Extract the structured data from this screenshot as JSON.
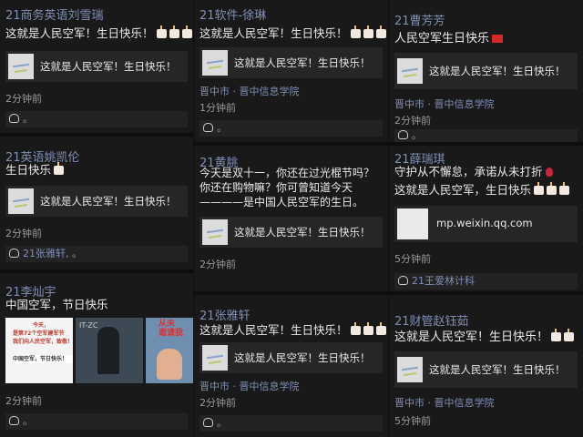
{
  "posts": {
    "p1": {
      "name": "21商务英语刘雪瑞",
      "text": "这就是人民空军！生日快乐！",
      "card": "这就是人民空军！生日快乐！",
      "time": "2分钟前",
      "likes": "。"
    },
    "p2": {
      "name": "21英语姚凯伦",
      "text": "生日快乐",
      "card": "这就是人民空军！生日快乐！",
      "time": "2分钟前",
      "likes": "21张雅轩, 。"
    },
    "p3": {
      "name": "21李灿宇",
      "text": "中国空军，节日快乐",
      "img1_lines": [
        "今天，",
        "是第72个空军建军节",
        "我们向人民空军，致敬！",
        "中国空军，节日快乐！"
      ],
      "img2_label": "IT-ZC",
      "img3_lines": [
        "从",
        "未",
        "邀",
        "请",
        "我"
      ],
      "time": "2分钟前",
      "likes": "。"
    },
    "p4": {
      "name": "21软件-徐琳",
      "text": "这就是人民空军！生日快乐！",
      "card": "这就是人民空军！生日快乐！",
      "loc": "晋中市 · 晋中信息学院",
      "time": "1分钟前",
      "likes": "。"
    },
    "p5": {
      "name": "21黄朓",
      "text": "今天是双十一，你还在过光棍节吗？你还在购物嘛？你可曾知道今天————是中国人民空军的生日。",
      "card": "这就是人民空军！生日快乐！",
      "time": "2分钟前",
      "likes": ""
    },
    "p6": {
      "name": "21张雅轩",
      "text": "这就是人民空军！生日快乐！",
      "card": "这就是人民空军！生日快乐！",
      "loc": "晋中市 · 晋中信息学院",
      "time": "2分钟前",
      "likes": "。"
    },
    "p7": {
      "name": "21曹芳芳",
      "text": "人民空军生日快乐",
      "card": "这就是人民空军！生日快乐！",
      "loc": "晋中市 · 晋中信息学院",
      "time": "2分钟前",
      "likes": "。"
    },
    "p8": {
      "name": "21薛瑞琪",
      "text1": "守护从不懈怠，承诺从未打折",
      "text2": "这就是人民空军，生日快乐",
      "card": "mp.weixin.qq.com",
      "time": "5分钟前",
      "likes": "21王爱林计科"
    },
    "p9": {
      "name": "21财管赵钰茹",
      "text": "这就是人民空军！生日快乐！",
      "card": "这就是人民空军！生日快乐！",
      "loc": "晋中市 · 晋中信息学院",
      "time": "5分钟前",
      "likes": ""
    }
  },
  "icons": [
    "heart-icon",
    "cake-icon",
    "china-flag-icon",
    "rose-icon",
    "thinking-face-icon"
  ]
}
